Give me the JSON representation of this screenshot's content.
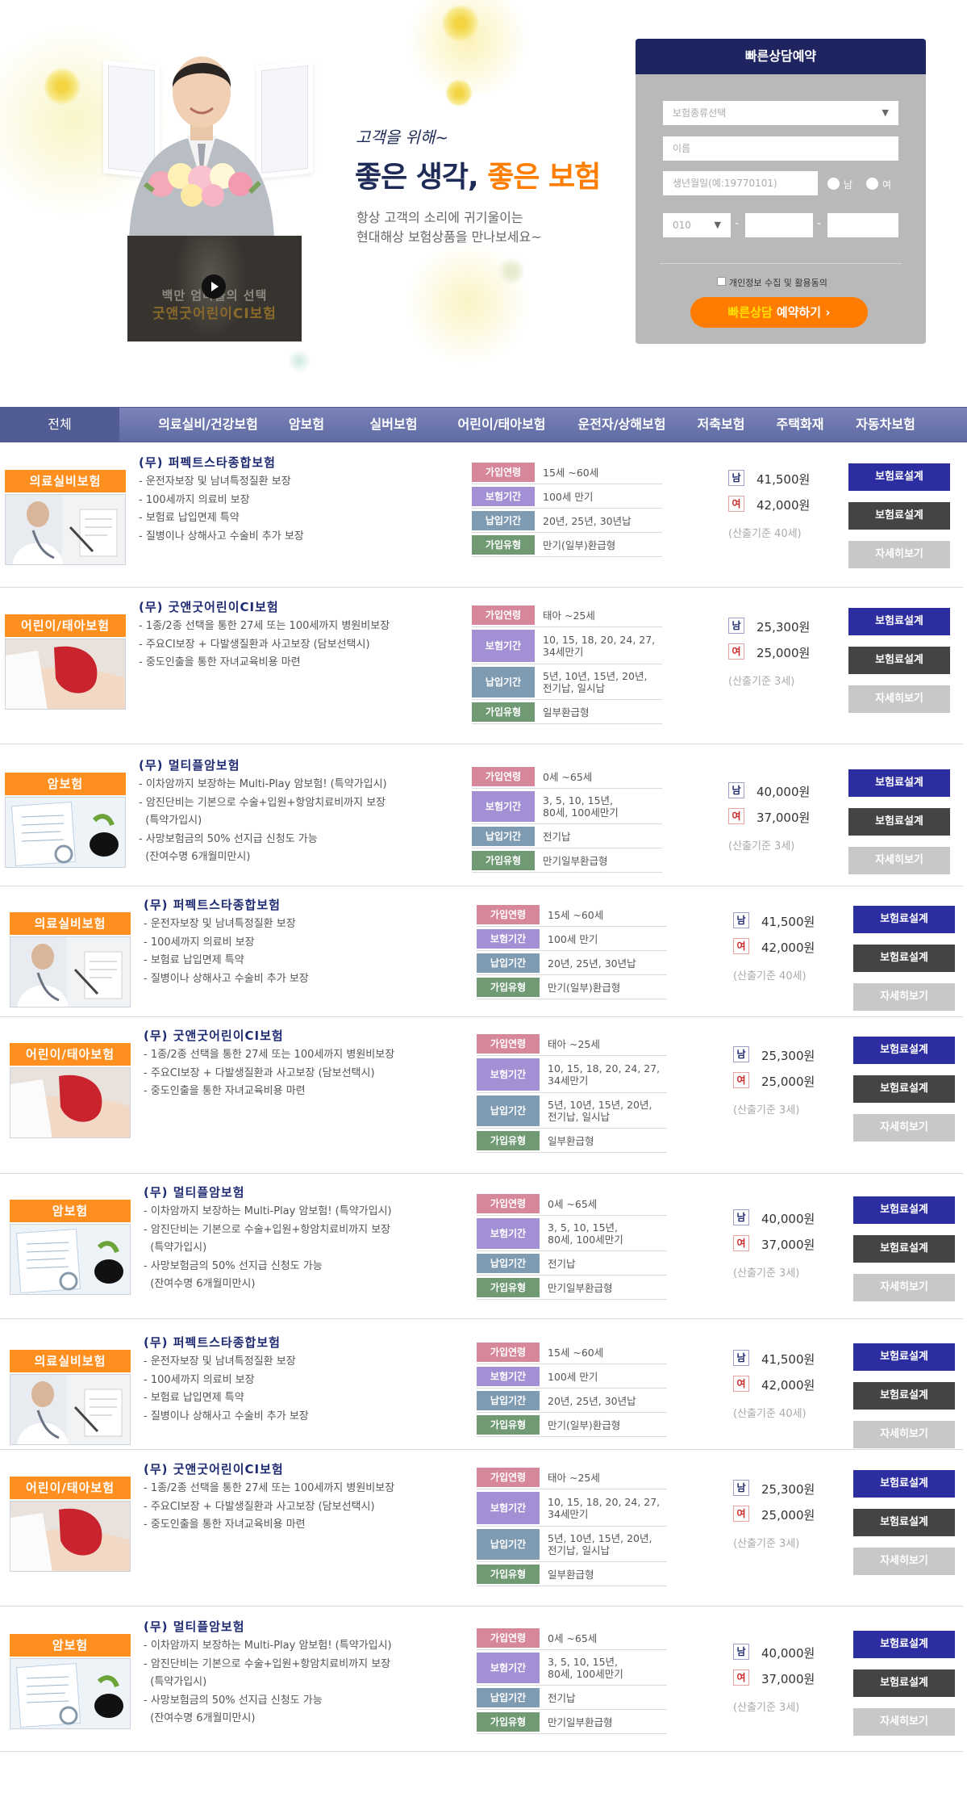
{
  "hero": {
    "slogan_small": "고객을 위해~",
    "slogan_part1": "좋은 생각,",
    "slogan_part2": "좋은 보험",
    "subtitle_line1": "항상 고객의 소리에 귀기울이는",
    "subtitle_line2": "현대해상 보험상품을 만나보세요~",
    "video_line1": "백만 엄마들의 선택",
    "video_line2": "굿앤굿어린이CI보험"
  },
  "form": {
    "title": "빠른상담예약",
    "insurance_type_placeholder": "보험종류선택",
    "name_placeholder": "이름",
    "birth_placeholder": "생년월일(예:19770101)",
    "gender_male": "남",
    "gender_female": "여",
    "phone_prefix": "010",
    "dash": "-",
    "privacy_label": "개인정보 수집 및 활용동의",
    "submit_part1": "빠른상담",
    "submit_part2": "예약하기",
    "submit_arrow": "›"
  },
  "tabs": {
    "all": "전체",
    "items": [
      "의료실비/건강보험",
      "암보험",
      "실버보험",
      "어린이/태아보험",
      "운전자/상해보험",
      "저축보험",
      "주택화재",
      "자동차보험"
    ]
  },
  "labels": {
    "age": "가입연령",
    "period": "보험기간",
    "pay": "납입기간",
    "type": "가입유형",
    "male": "남",
    "female": "여",
    "btn_design": "보험료설계",
    "btn_detail": "자세히보기"
  },
  "products": [
    {
      "category": "의료실비보험",
      "name": "(무) 퍼펙트스타종합보험",
      "features": [
        "- 운전자보장 및 남녀특정질환 보장",
        "- 100세까지 의료비 보장",
        "- 보험료 납입면제 특약",
        "- 질병이나 상해사고 수술비 추가 보장"
      ],
      "age": "15세 ~60세",
      "period": "100세 만기",
      "pay": "20년, 25년, 30년납",
      "type": "만기(일부)환급형",
      "male_price": "41,500원",
      "female_price": "42,000원",
      "note": "(산출기준 40세)"
    },
    {
      "category": "어린이/태아보험",
      "name": "(무) 굿앤굿어린이CI보험",
      "features": [
        "- 1종/2종 선택을 통한 27세 또는 100세까지 병원비보장",
        "- 주요CI보장 + 다발생질환과 사고보장 (담보선택시)",
        "- 중도인출을 통한 자녀교육비용 마련"
      ],
      "age": "태아 ~25세",
      "period": "10, 15, 18, 20, 24, 27,\n34세만기",
      "pay": "5년, 10년, 15년, 20년,\n전기납, 일시납",
      "type": "일부환급형",
      "male_price": "25,300원",
      "female_price": "25,000원",
      "note": "(산출기준 3세)"
    },
    {
      "category": "암보험",
      "name": "(무) 멀티플암보험",
      "features": [
        "- 이차암까지 보장하는 Multi-Play 암보험! (특약가입시)",
        "- 암진단비는 기본으로 수술+입원+항암치료비까지 보장",
        "  (특약가입시)",
        "- 사망보험금의 50% 선지급 신청도 가능",
        "  (잔여수명 6개월미만시)"
      ],
      "age": "0세 ~65세",
      "period": "3, 5, 10, 15년,\n80세, 100세만기",
      "pay": "전기납",
      "type": "만기일부환급형",
      "male_price": "40,000원",
      "female_price": "37,000원",
      "note": "(산출기준 3세)"
    }
  ]
}
